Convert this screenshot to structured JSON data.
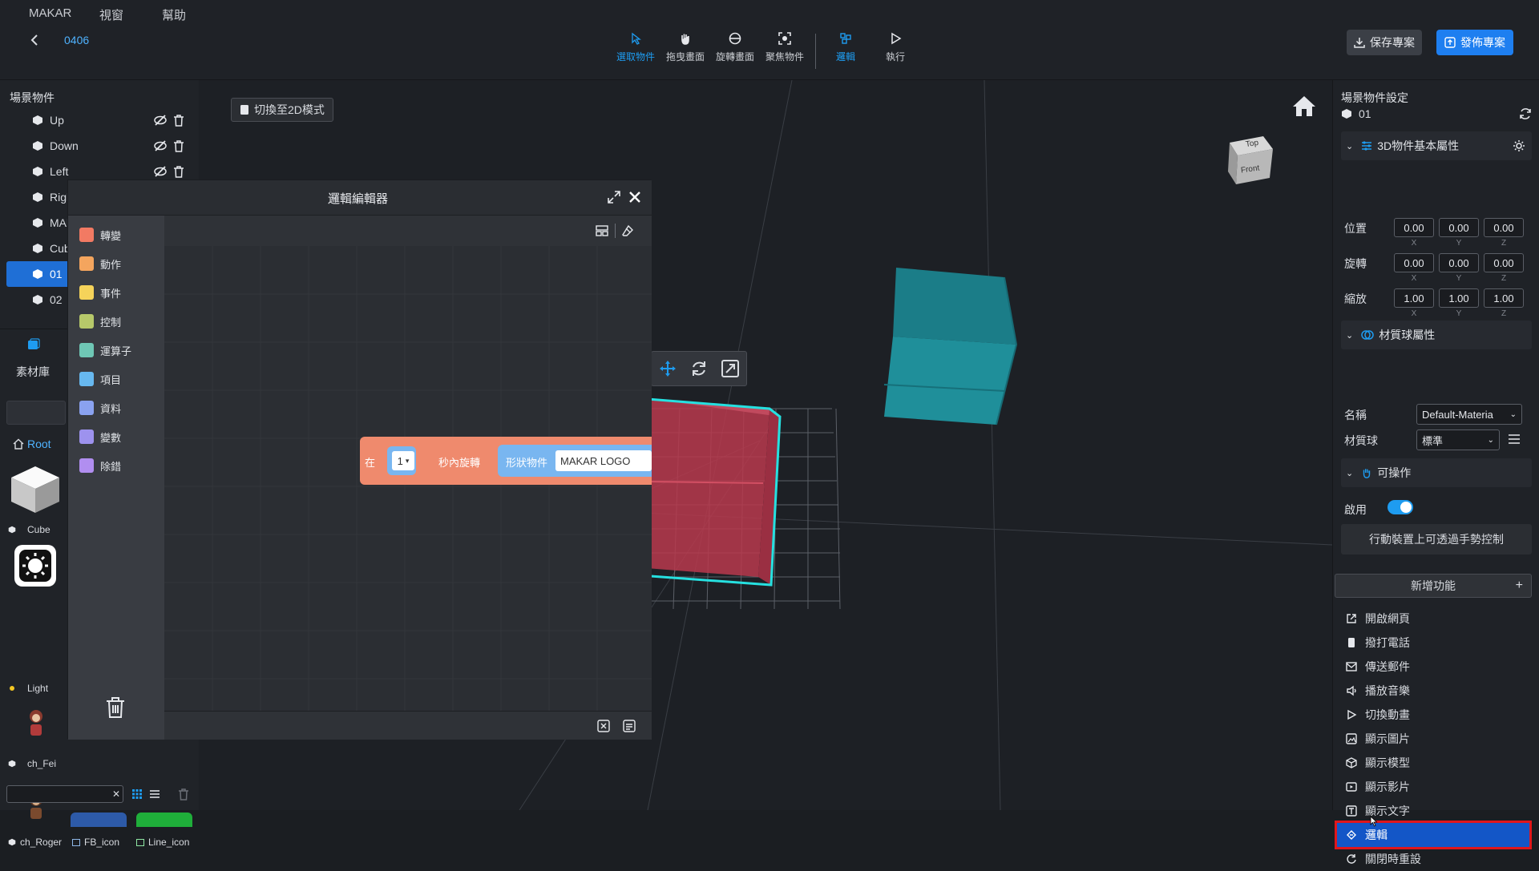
{
  "menu": [
    "MAKAR",
    "視窗",
    "幫助"
  ],
  "project_name": "0406",
  "tools": [
    {
      "label": "選取物件",
      "icon": "cursor-icon"
    },
    {
      "label": "拖曳畫面",
      "icon": "hand-icon"
    },
    {
      "label": "旋轉畫面",
      "icon": "rotate-view-icon"
    },
    {
      "label": "聚焦物件",
      "icon": "focus-icon"
    },
    {
      "label": "邏輯",
      "icon": "logic-icon"
    },
    {
      "label": "執行",
      "icon": "play-icon"
    }
  ],
  "save_label": "保存專案",
  "publish_label": "發佈專案",
  "scene": {
    "title": "場景物件",
    "items": [
      "Up",
      "Down",
      "Left",
      "Rigl",
      "MAl",
      "Cub",
      "01",
      "02"
    ],
    "selected": "01"
  },
  "assets": {
    "title": "素材庫",
    "root": "Root",
    "items": [
      "Cube",
      "Light",
      "ch_Fei",
      "ch_Roger",
      "FB_icon",
      "Line_icon"
    ]
  },
  "viewport": {
    "switch_2d": "切換至2D模式",
    "cube_top": "Top",
    "cube_front": "Front"
  },
  "editor": {
    "title": "邏輯編輯器",
    "categories": [
      {
        "label": "轉變",
        "color": "#f27a63"
      },
      {
        "label": "動作",
        "color": "#f4a55e"
      },
      {
        "label": "事件",
        "color": "#f5d35a"
      },
      {
        "label": "控制",
        "color": "#b7c96a"
      },
      {
        "label": "運算子",
        "color": "#6fc7b5"
      },
      {
        "label": "項目",
        "color": "#67b8ef"
      },
      {
        "label": "資料",
        "color": "#8aa2f0"
      },
      {
        "label": "變數",
        "color": "#9d92ee"
      },
      {
        "label": "除錯",
        "color": "#b18ef0"
      }
    ],
    "block": {
      "prefix": "在",
      "seconds": "1",
      "mid": "秒內旋轉",
      "shape": "形狀物件",
      "target": "MAKAR LOGO"
    }
  },
  "props": {
    "title": "場景物件設定",
    "object": "01",
    "basic": "3D物件基本屬性",
    "position_label": "位置",
    "rotation_label": "旋轉",
    "scale_label": "縮放",
    "position": [
      "0.00",
      "0.00",
      "0.00"
    ],
    "rotation": [
      "0.00",
      "0.00",
      "0.00"
    ],
    "scale": [
      "1.00",
      "1.00",
      "1.00"
    ],
    "axes": [
      "X",
      "Y",
      "Z"
    ],
    "material_title": "材質球屬性",
    "name_label": "名稱",
    "name_value": "Default-Materia",
    "material_label": "材質球",
    "material_value": "標準",
    "operable_title": "可操作",
    "enable_label": "啟用",
    "gesture_label": "行動裝置上可透過手勢控制",
    "add_feature": "新增功能",
    "features": [
      {
        "label": "開啟網頁",
        "icon": "external-link-icon"
      },
      {
        "label": "撥打電話",
        "icon": "phone-icon"
      },
      {
        "label": "傳送郵件",
        "icon": "mail-icon"
      },
      {
        "label": "播放音樂",
        "icon": "speaker-icon"
      },
      {
        "label": "切換動畫",
        "icon": "play-outline-icon"
      },
      {
        "label": "顯示圖片",
        "icon": "image-icon"
      },
      {
        "label": "顯示模型",
        "icon": "box-icon"
      },
      {
        "label": "顯示影片",
        "icon": "video-icon"
      },
      {
        "label": "顯示文字",
        "icon": "text-icon"
      },
      {
        "label": "邏輯",
        "icon": "logic-icon"
      },
      {
        "label": "關閉時重設",
        "icon": "reset-icon"
      }
    ],
    "highlight": "邏輯"
  },
  "colors": {
    "accent": "#1e9cf0",
    "panel": "#1f2227",
    "highlight_border": "#e0161b",
    "selected_row": "#1f6fd6"
  }
}
